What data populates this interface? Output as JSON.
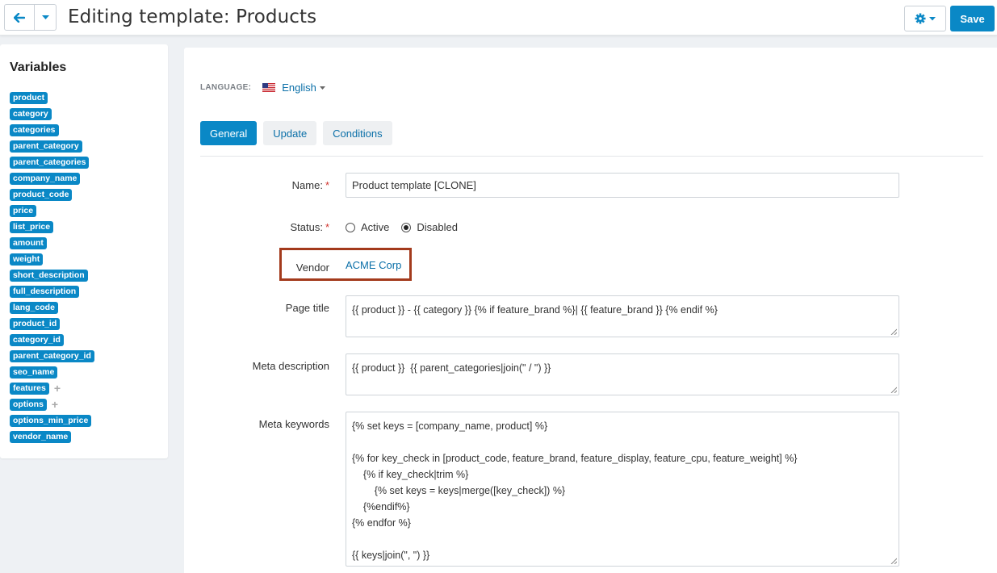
{
  "header": {
    "title": "Editing template: Products",
    "save_label": "Save"
  },
  "sidebar": {
    "title": "Variables",
    "variables": [
      {
        "name": "product",
        "expandable": false
      },
      {
        "name": "category",
        "expandable": false
      },
      {
        "name": "categories",
        "expandable": false
      },
      {
        "name": "parent_category",
        "expandable": false
      },
      {
        "name": "parent_categories",
        "expandable": false
      },
      {
        "name": "company_name",
        "expandable": false
      },
      {
        "name": "product_code",
        "expandable": false
      },
      {
        "name": "price",
        "expandable": false
      },
      {
        "name": "list_price",
        "expandable": false
      },
      {
        "name": "amount",
        "expandable": false
      },
      {
        "name": "weight",
        "expandable": false
      },
      {
        "name": "short_description",
        "expandable": false
      },
      {
        "name": "full_description",
        "expandable": false
      },
      {
        "name": "lang_code",
        "expandable": false
      },
      {
        "name": "product_id",
        "expandable": false
      },
      {
        "name": "category_id",
        "expandable": false
      },
      {
        "name": "parent_category_id",
        "expandable": false
      },
      {
        "name": "seo_name",
        "expandable": false
      },
      {
        "name": "features",
        "expandable": true
      },
      {
        "name": "options",
        "expandable": true
      },
      {
        "name": "options_min_price",
        "expandable": false
      },
      {
        "name": "vendor_name",
        "expandable": false
      }
    ]
  },
  "language": {
    "label": "LANGUAGE:",
    "value": "English"
  },
  "tabs": [
    {
      "label": "General",
      "active": true
    },
    {
      "label": "Update",
      "active": false
    },
    {
      "label": "Conditions",
      "active": false
    }
  ],
  "form": {
    "name": {
      "label": "Name:",
      "value": "Product template [CLONE]"
    },
    "status": {
      "label": "Status:",
      "options": [
        {
          "label": "Active",
          "checked": false
        },
        {
          "label": "Disabled",
          "checked": true
        }
      ]
    },
    "vendor": {
      "label": "Vendor",
      "value": "ACME Corp"
    },
    "page_title": {
      "label": "Page title",
      "value": "{{ product }} - {{ category }} {% if feature_brand %}| {{ feature_brand }} {% endif %}"
    },
    "meta_description": {
      "label": "Meta description",
      "value": "{{ product }}  {{ parent_categories|join(\" / \") }}"
    },
    "meta_keywords": {
      "label": "Meta keywords",
      "value": "{% set keys = [company_name, product] %}\n\n{% for key_check in [product_code, feature_brand, feature_display, feature_cpu, feature_weight] %}\n    {% if key_check|trim %}\n        {% set keys = keys|merge([key_check]) %}\n    {%endif%}\n{% endfor %}\n\n{{ keys|join(\", \") }}"
    }
  },
  "colors": {
    "accent": "#0a88c6",
    "link": "#0a6fa8",
    "required": "#d0332d",
    "highlight_box": "#a33a1c"
  }
}
